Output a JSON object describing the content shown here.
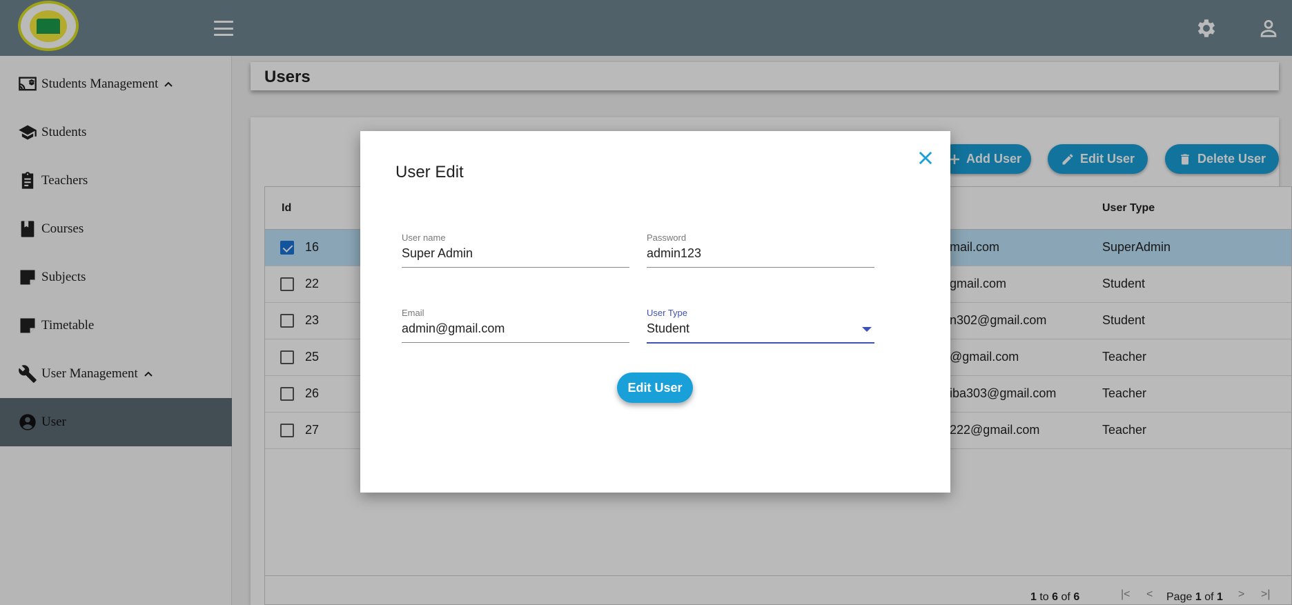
{
  "header": {
    "logo_alt": "school-logo"
  },
  "sidebar": {
    "items": [
      {
        "label": "Students Management",
        "icon": "cast-for-education-icon",
        "expandable": true
      },
      {
        "label": "Students",
        "icon": "school-icon"
      },
      {
        "label": "Teachers",
        "icon": "clipboard-icon"
      },
      {
        "label": "Courses",
        "icon": "book-icon"
      },
      {
        "label": "Subjects",
        "icon": "note-icon"
      },
      {
        "label": "Timetable",
        "icon": "note-icon"
      },
      {
        "label": "User Management",
        "icon": "wrench-icon",
        "expandable": true
      },
      {
        "label": "User",
        "icon": "account-circle-icon",
        "active": true
      }
    ]
  },
  "page": {
    "title": "Users"
  },
  "toolbar": {
    "add_label": "Add User",
    "edit_label": "Edit User",
    "delete_label": "Delete User"
  },
  "grid": {
    "columns": {
      "id": "Id",
      "type": "User Type"
    },
    "rows": [
      {
        "id": "16",
        "email": "mail.com",
        "type": "SuperAdmin",
        "selected": true
      },
      {
        "id": "22",
        "email": "gmail.com",
        "type": "Student"
      },
      {
        "id": "23",
        "email": "n302@gmail.com",
        "type": "Student"
      },
      {
        "id": "25",
        "email": "@gmail.com",
        "type": "Teacher"
      },
      {
        "id": "26",
        "email": "iba303@gmail.com",
        "type": "Teacher"
      },
      {
        "id": "27",
        "email": "222@gmail.com",
        "type": "Teacher"
      }
    ],
    "footer": {
      "from": "1",
      "to_word": "to",
      "to": "6",
      "of_word": "of",
      "total": "6",
      "page_word": "Page",
      "page": "1",
      "page_of_word": "of",
      "pages": "1"
    }
  },
  "modal": {
    "title": "User Edit",
    "username": {
      "label": "User name",
      "value": "Super Admin"
    },
    "password": {
      "label": "Password",
      "value": "admin123"
    },
    "email": {
      "label": "Email",
      "value": "admin@gmail.com"
    },
    "usertype": {
      "label": "User Type",
      "value": "Student"
    },
    "submit_label": "Edit User"
  },
  "colors": {
    "accent": "#1aa0d8",
    "header": "#6e8591",
    "focus": "#3f51b5"
  }
}
